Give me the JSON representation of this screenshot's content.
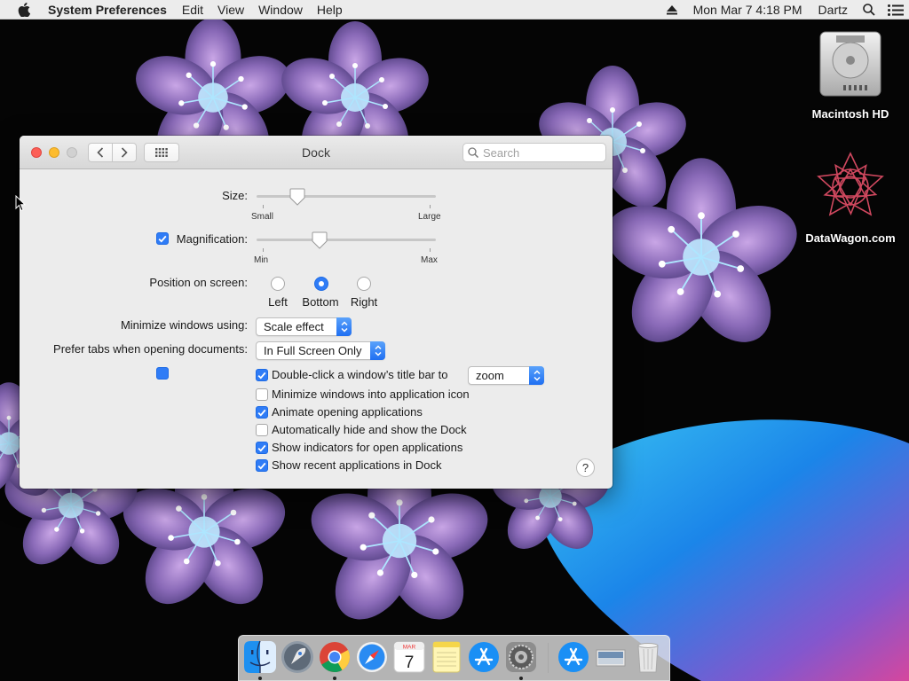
{
  "menubar": {
    "app_name": "System Preferences",
    "menus": [
      "Edit",
      "View",
      "Window",
      "Help"
    ],
    "clock": "Mon Mar 7  4:18 PM",
    "user": "Dartz",
    "icons": [
      "apple-icon",
      "eject-icon",
      "spotlight-search-icon",
      "notification-list-icon"
    ]
  },
  "desktop": {
    "icons": [
      {
        "label": "Macintosh HD",
        "icon": "hard-drive-icon"
      },
      {
        "label": "DataWagon.com",
        "icon": "geometric-logo-icon"
      }
    ]
  },
  "window": {
    "title": "Dock",
    "search_placeholder": "Search",
    "toolbar_icons": [
      "back-chevron-icon",
      "forward-chevron-icon",
      "show-all-grid-icon"
    ],
    "size": {
      "label": "Size:",
      "min_label": "Small",
      "max_label": "Large",
      "value_fraction": 0.23
    },
    "magnification": {
      "label": "Magnification:",
      "checked": true,
      "min_label": "Min",
      "max_label": "Max",
      "value_fraction": 0.35
    },
    "position": {
      "label": "Position on screen:",
      "options": [
        "Left",
        "Bottom",
        "Right"
      ],
      "selected": "Bottom"
    },
    "minimize_using": {
      "label": "Minimize windows using:",
      "value": "Scale effect"
    },
    "prefer_tabs": {
      "label": "Prefer tabs when opening documents:",
      "value": "In Full Screen Only"
    },
    "double_click": {
      "label": "Double-click a window’s title bar to",
      "checked": true,
      "value": "zoom"
    },
    "options": [
      {
        "label": "Minimize windows into application icon",
        "checked": false
      },
      {
        "label": "Animate opening applications",
        "checked": true
      },
      {
        "label": "Automatically hide and show the Dock",
        "checked": false
      },
      {
        "label": "Show indicators for open applications",
        "checked": true
      },
      {
        "label": "Show recent applications in Dock",
        "checked": true
      }
    ],
    "help_label": "?"
  },
  "dock": {
    "apps": [
      {
        "name": "finder-icon",
        "running": true
      },
      {
        "name": "launchpad-icon",
        "running": false
      },
      {
        "name": "chrome-icon",
        "running": true
      },
      {
        "name": "safari-icon",
        "running": false
      },
      {
        "name": "calendar-icon",
        "running": false,
        "month": "MAR",
        "day": "7"
      },
      {
        "name": "notes-icon",
        "running": false
      },
      {
        "name": "app-store-icon",
        "running": false
      },
      {
        "name": "system-preferences-icon",
        "running": true
      },
      {
        "name": "downloads-app-store-icon",
        "running": false
      },
      {
        "name": "documents-folder-icon",
        "running": false
      },
      {
        "name": "trash-icon",
        "running": false
      }
    ]
  },
  "colors": {
    "accent": "#2f7cf6",
    "close": "#fc5f57",
    "minimize": "#fdbc2e",
    "zoom": "#d1d1d1"
  }
}
